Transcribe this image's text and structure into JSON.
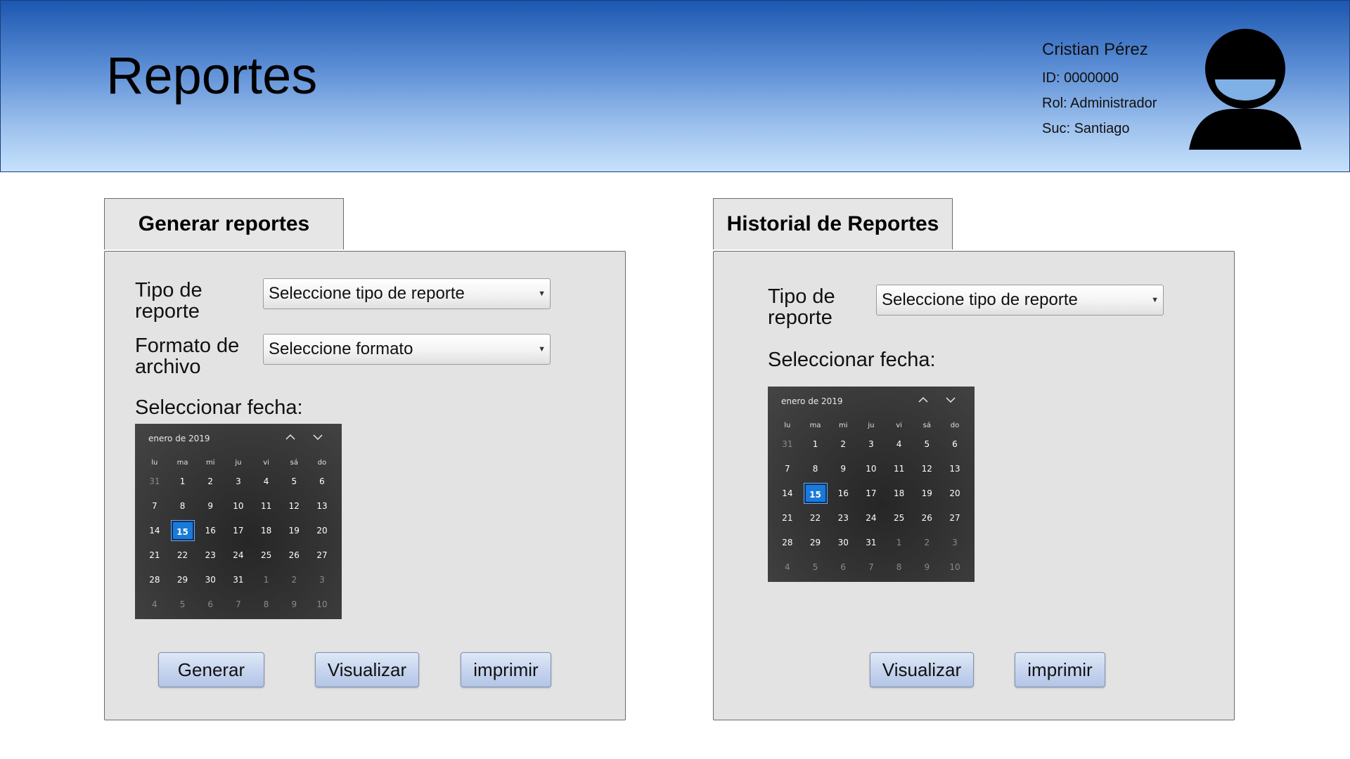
{
  "header": {
    "title": "Reportes",
    "user": {
      "name": "Cristian Pérez",
      "id": "ID: 0000000",
      "role": "Rol: Administrador",
      "branch": "Suc: Santiago"
    }
  },
  "generate": {
    "tab_label": "Generar reportes",
    "type_label": "Tipo de reporte",
    "type_placeholder": "Seleccione tipo de reporte",
    "format_label": "Formato de archivo",
    "format_placeholder": "Seleccione formato",
    "date_label": "Seleccionar fecha:",
    "buttons": {
      "generate": "Generar",
      "view": "Visualizar",
      "print": "imprimir"
    }
  },
  "history": {
    "tab_label": "Historial de Reportes",
    "type_label": "Tipo de reporte",
    "type_placeholder": "Seleccione tipo de reporte",
    "date_label": "Seleccionar fecha:",
    "buttons": {
      "view": "Visualizar",
      "print": "imprimir"
    }
  },
  "calendar": {
    "month_label": "enero de 2019",
    "weekdays": [
      "lu",
      "ma",
      "mi",
      "ju",
      "vi",
      "sá",
      "do"
    ],
    "selected_day": "15",
    "weeks": [
      [
        "31",
        "1",
        "2",
        "3",
        "4",
        "5",
        "6"
      ],
      [
        "7",
        "8",
        "9",
        "10",
        "11",
        "12",
        "13"
      ],
      [
        "14",
        "15",
        "16",
        "17",
        "18",
        "19",
        "20"
      ],
      [
        "21",
        "22",
        "23",
        "24",
        "25",
        "26",
        "27"
      ],
      [
        "28",
        "29",
        "30",
        "31",
        "1",
        "2",
        "3"
      ],
      [
        "4",
        "5",
        "6",
        "7",
        "8",
        "9",
        "10"
      ]
    ],
    "dim_cells": [
      [
        0,
        0
      ],
      [
        4,
        4
      ],
      [
        4,
        5
      ],
      [
        4,
        6
      ],
      [
        5,
        0
      ],
      [
        5,
        1
      ],
      [
        5,
        2
      ],
      [
        5,
        3
      ],
      [
        5,
        4
      ],
      [
        5,
        5
      ],
      [
        5,
        6
      ]
    ]
  }
}
